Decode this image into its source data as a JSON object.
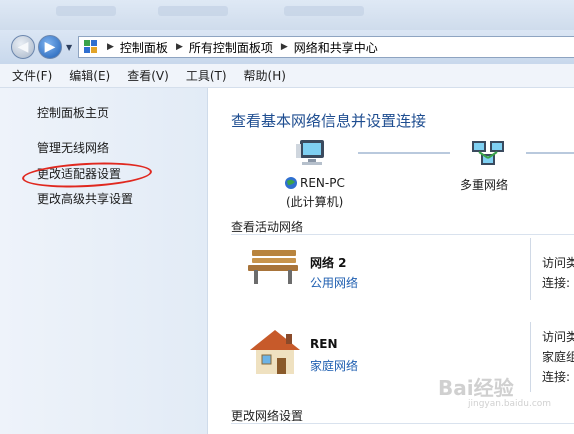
{
  "breadcrumb": [
    "控制面板",
    "所有控制面板项",
    "网络和共享中心"
  ],
  "menu": [
    "文件(F)",
    "编辑(E)",
    "查看(V)",
    "工具(T)",
    "帮助(H)"
  ],
  "sidebar": {
    "items": [
      {
        "label": "控制面板主页"
      },
      {
        "label": "管理无线网络"
      },
      {
        "label": "更改适配器设置"
      },
      {
        "label": "更改高级共享设置"
      }
    ]
  },
  "main": {
    "title": "查看基本网络信息并设置连接",
    "map": {
      "computer_name": "REN-PC",
      "computer_sub": "(此计算机)",
      "network_label": "多重网络"
    },
    "active_label": "查看活动网络",
    "networks": [
      {
        "name": "网络  2",
        "type": "公用网络",
        "side": [
          "访问类",
          "连接:"
        ]
      },
      {
        "name": "REN",
        "type": "家庭网络",
        "side": [
          "访问类",
          "家庭组",
          "连接:"
        ]
      }
    ],
    "change_label": "更改网络设置"
  },
  "watermark": {
    "text": "Bai经验",
    "sub": "jingyan.baidu.com"
  },
  "colors": {
    "accent": "#1e4d90",
    "link": "#1f5fb1",
    "annotation": "#e0281f"
  }
}
